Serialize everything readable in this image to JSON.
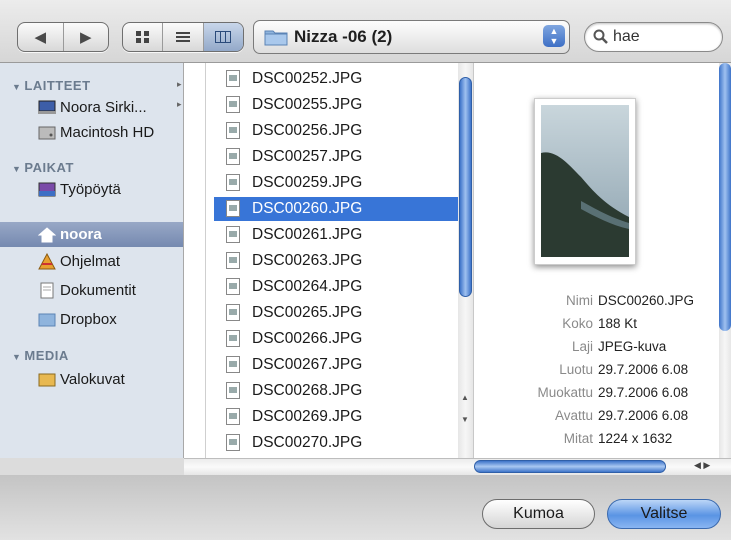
{
  "toolbar": {
    "back_icon": "back-arrow-icon",
    "forward_icon": "forward-arrow-icon",
    "view_modes": [
      "icon-view-icon",
      "list-view-icon",
      "column-view-icon"
    ],
    "active_view": "column-view-icon",
    "location": "Nizza -06 (2)",
    "search_value": "hae"
  },
  "sidebar": {
    "sections": [
      {
        "title": "LAITTEET",
        "items": [
          "Noora Sirki...",
          "Macintosh HD"
        ]
      },
      {
        "title": "PAIKAT",
        "items": [
          "Työpöytä",
          "noora",
          "Ohjelmat",
          "Dokumentit",
          "Dropbox"
        ]
      },
      {
        "title": "MEDIA",
        "items": [
          "Valokuvat"
        ]
      }
    ],
    "selected": "noora"
  },
  "files": [
    "DSC00252.JPG",
    "DSC00255.JPG",
    "DSC00256.JPG",
    "DSC00257.JPG",
    "DSC00259.JPG",
    "DSC00260.JPG",
    "DSC00261.JPG",
    "DSC00263.JPG",
    "DSC00264.JPG",
    "DSC00265.JPG",
    "DSC00266.JPG",
    "DSC00267.JPG",
    "DSC00268.JPG",
    "DSC00269.JPG",
    "DSC00270.JPG"
  ],
  "selected_file": "DSC00260.JPG",
  "preview": {
    "fields": [
      {
        "key": "Nimi",
        "value": "DSC00260.JPG"
      },
      {
        "key": "Koko",
        "value": "188 Kt"
      },
      {
        "key": "Laji",
        "value": "JPEG-kuva"
      },
      {
        "key": "Luotu",
        "value": "29.7.2006 6.08"
      },
      {
        "key": "Muokattu",
        "value": "29.7.2006 6.08"
      },
      {
        "key": "Avattu",
        "value": "29.7.2006 6.08"
      },
      {
        "key": "Mitat",
        "value": "1224 x 1632"
      }
    ]
  },
  "buttons": {
    "cancel": "Kumoa",
    "choose": "Valitse"
  },
  "colors": {
    "selection": "#3875d7",
    "sidebar_bg": "#dde4ed",
    "accent": "#3e74c9"
  }
}
